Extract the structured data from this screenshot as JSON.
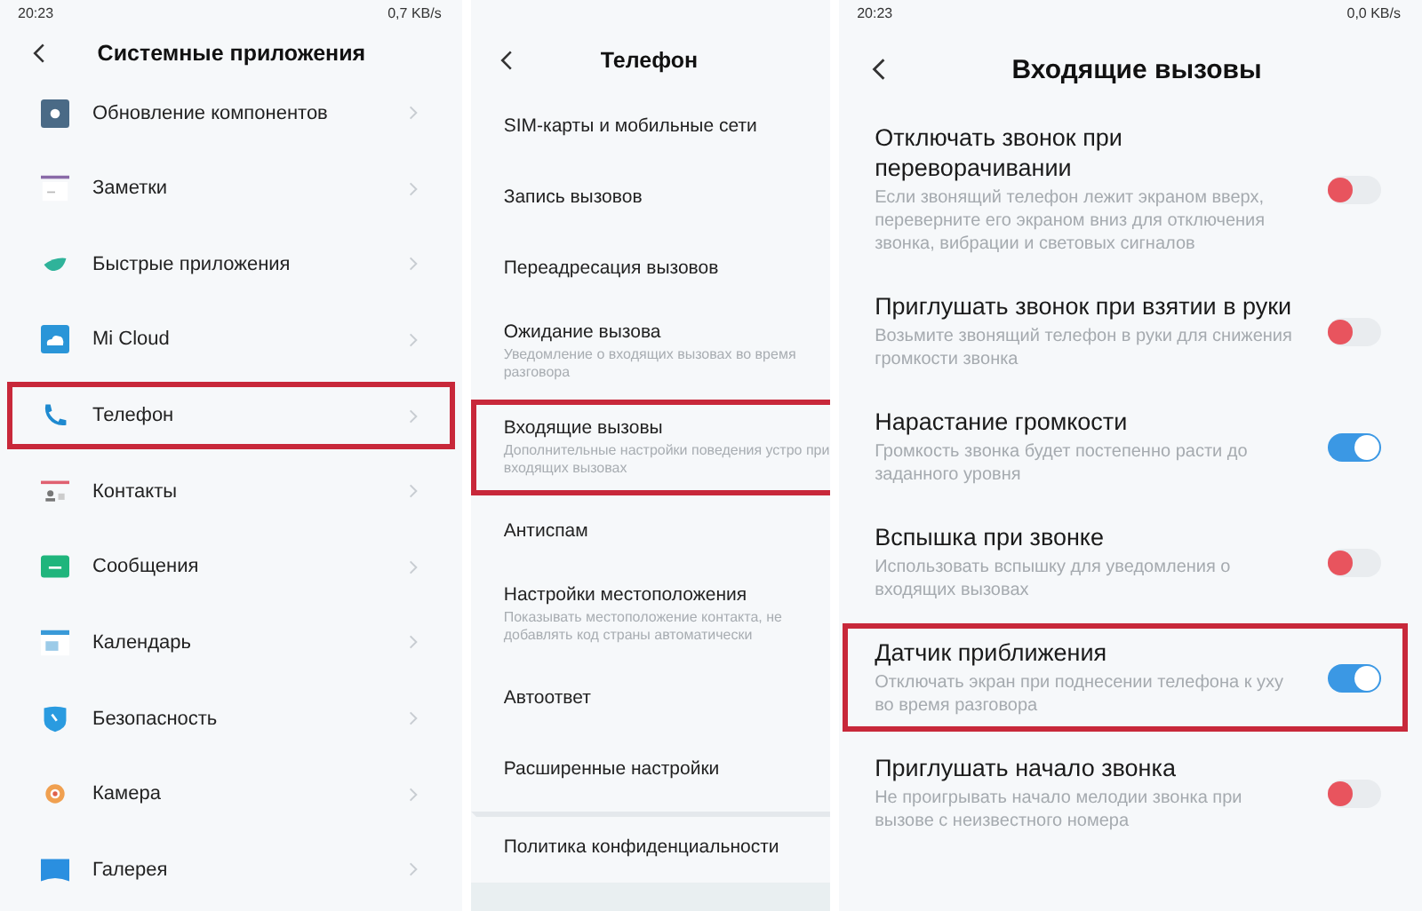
{
  "panels": [
    {
      "status": {
        "time": "20:23",
        "speed": "0,7 KB/s"
      },
      "title": "Системные приложения",
      "items": [
        {
          "label": "Обновление компонентов",
          "highlighted": false
        },
        {
          "label": "Заметки",
          "highlighted": false
        },
        {
          "label": "Быстрые приложения",
          "highlighted": false
        },
        {
          "label": "Mi Cloud",
          "highlighted": false
        },
        {
          "label": "Телефон",
          "highlighted": true
        },
        {
          "label": "Контакты",
          "highlighted": false
        },
        {
          "label": "Сообщения",
          "highlighted": false
        },
        {
          "label": "Календарь",
          "highlighted": false
        },
        {
          "label": "Безопасность",
          "highlighted": false
        },
        {
          "label": "Камера",
          "highlighted": false
        },
        {
          "label": "Галерея",
          "highlighted": false
        }
      ]
    },
    {
      "title": "Телефон",
      "items": [
        {
          "label": "SIM-карты и мобильные сети",
          "highlighted": false
        },
        {
          "label": "Запись вызовов",
          "highlighted": false
        },
        {
          "label": "Переадресация вызовов",
          "highlighted": false
        },
        {
          "label": "Ожидание вызова",
          "description": "Уведомление о входящих вызовах во время разговора",
          "highlighted": false
        },
        {
          "label": "Входящие вызовы",
          "description": "Дополнительные настройки поведения устро при входящих вызовах",
          "highlighted": true
        },
        {
          "label": "Антиспам",
          "highlighted": false
        },
        {
          "label": "Настройки местоположения",
          "description": "Показывать местоположение контакта, не добавлять код страны автоматически",
          "highlighted": false
        },
        {
          "label": "Автоответ",
          "highlighted": false
        },
        {
          "label": "Расширенные настройки",
          "highlighted": false
        },
        {
          "label": "Политика конфиденциальности",
          "highlighted": false,
          "separated": true
        }
      ]
    },
    {
      "status": {
        "time": "20:23",
        "speed": "0,0 KB/s"
      },
      "title": "Входящие вызовы",
      "settings": [
        {
          "label": "Отключать звонок при переворачивании",
          "description": "Если звонящий телефон лежит экраном вверх, переверните его экраном вниз для отключения звонка, вибрации и световых сигналов",
          "on": false,
          "highlighted": false
        },
        {
          "label": "Приглушать звонок при взятии в руки",
          "description": "Возьмите звонящий телефон в руки для снижения громкости звонка",
          "on": false,
          "highlighted": false
        },
        {
          "label": "Нарастание громкости",
          "description": "Громкость звонка будет постепенно расти до заданного уровня",
          "on": true,
          "highlighted": false
        },
        {
          "label": "Вспышка при звонке",
          "description": "Использовать вспышку для уведомления о входящих вызовах",
          "on": false,
          "highlighted": false
        },
        {
          "label": "Датчик приближения",
          "description": "Отключать экран при поднесении телефона к уху во время разговора",
          "on": true,
          "highlighted": true
        },
        {
          "label": "Приглушать начало звонка",
          "description": "Не проигрывать начало мелодии звонка при вызове с неизвестного номера",
          "on": false,
          "highlighted": false
        }
      ]
    }
  ]
}
